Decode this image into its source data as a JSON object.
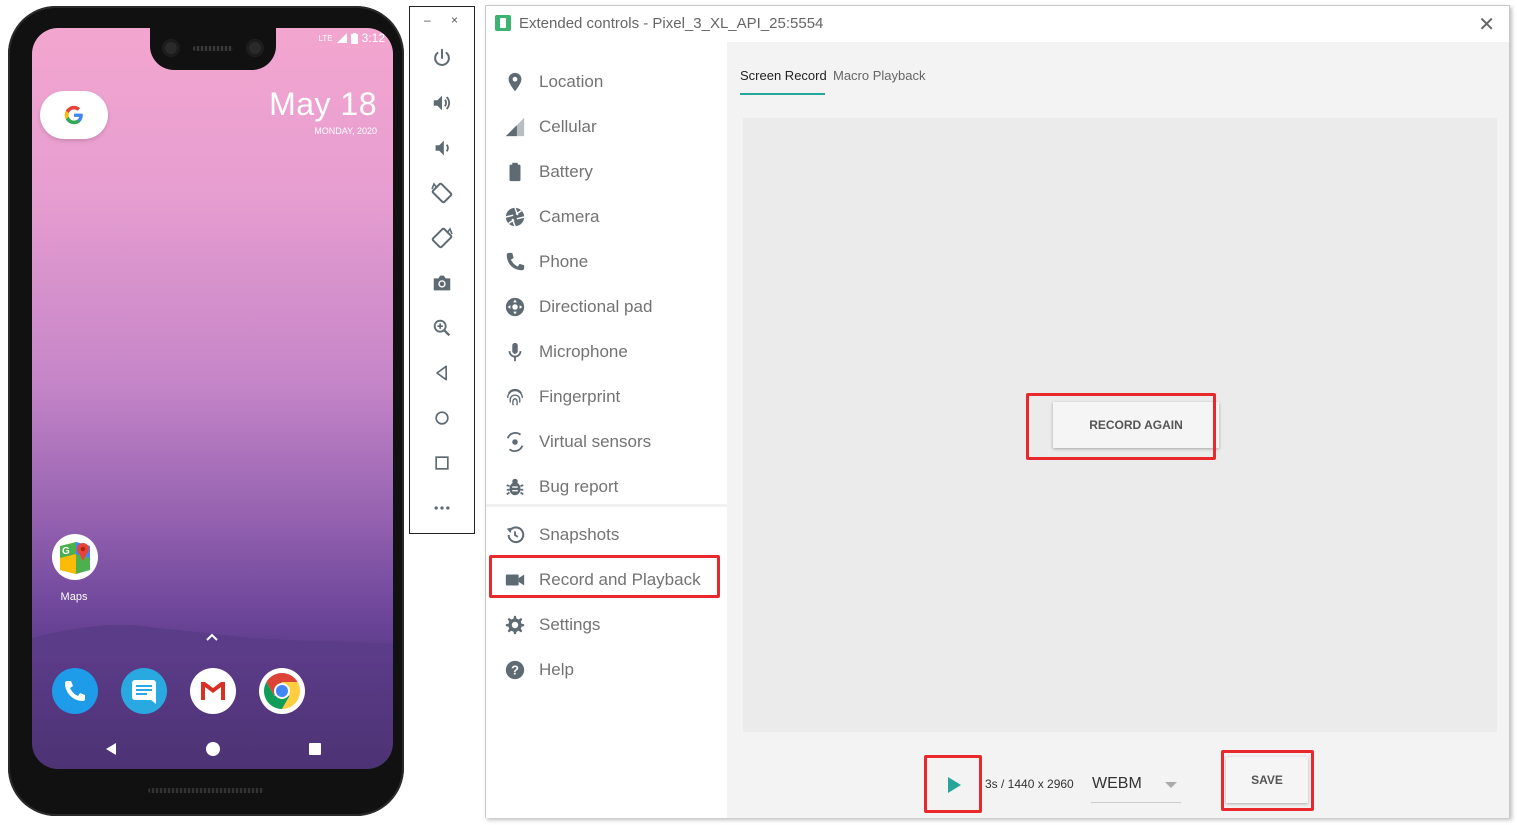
{
  "phone": {
    "status_network": "LTE",
    "status_time": "3:12",
    "date": "May 18",
    "day_of_week": "MONDAY, 2020",
    "apps": {
      "maps_label": "Maps"
    }
  },
  "toolbar": {
    "minimize_label": "–",
    "close_label": "×",
    "buttons": [
      "power-icon",
      "volume-up-icon",
      "volume-down-icon",
      "rotate-left-icon",
      "rotate-right-icon",
      "camera-icon",
      "zoom-icon",
      "back-icon",
      "home-icon",
      "overview-icon",
      "more-icon"
    ]
  },
  "window": {
    "title": "Extended controls - Pixel_3_XL_API_25:5554",
    "close_label": "✕"
  },
  "sidebar": {
    "items": [
      {
        "label": "Location"
      },
      {
        "label": "Cellular"
      },
      {
        "label": "Battery"
      },
      {
        "label": "Camera"
      },
      {
        "label": "Phone"
      },
      {
        "label": "Directional pad"
      },
      {
        "label": "Microphone"
      },
      {
        "label": "Fingerprint"
      },
      {
        "label": "Virtual sensors"
      },
      {
        "label": "Bug report"
      },
      {
        "label": "Snapshots"
      },
      {
        "label": "Record and Playback"
      },
      {
        "label": "Settings"
      },
      {
        "label": "Help"
      }
    ],
    "selected": "Record and Playback"
  },
  "tabs": [
    {
      "label": "Screen Record"
    },
    {
      "label": "Macro Playback"
    }
  ],
  "record": {
    "record_again_label": "RECORD AGAIN",
    "info": "3s / 1440 x 2960",
    "format_value": "WEBM",
    "save_label": "SAVE"
  },
  "colors": {
    "accent": "#26a69a",
    "highlight": "#e8282a",
    "icon_gray": "#5f6b73"
  }
}
